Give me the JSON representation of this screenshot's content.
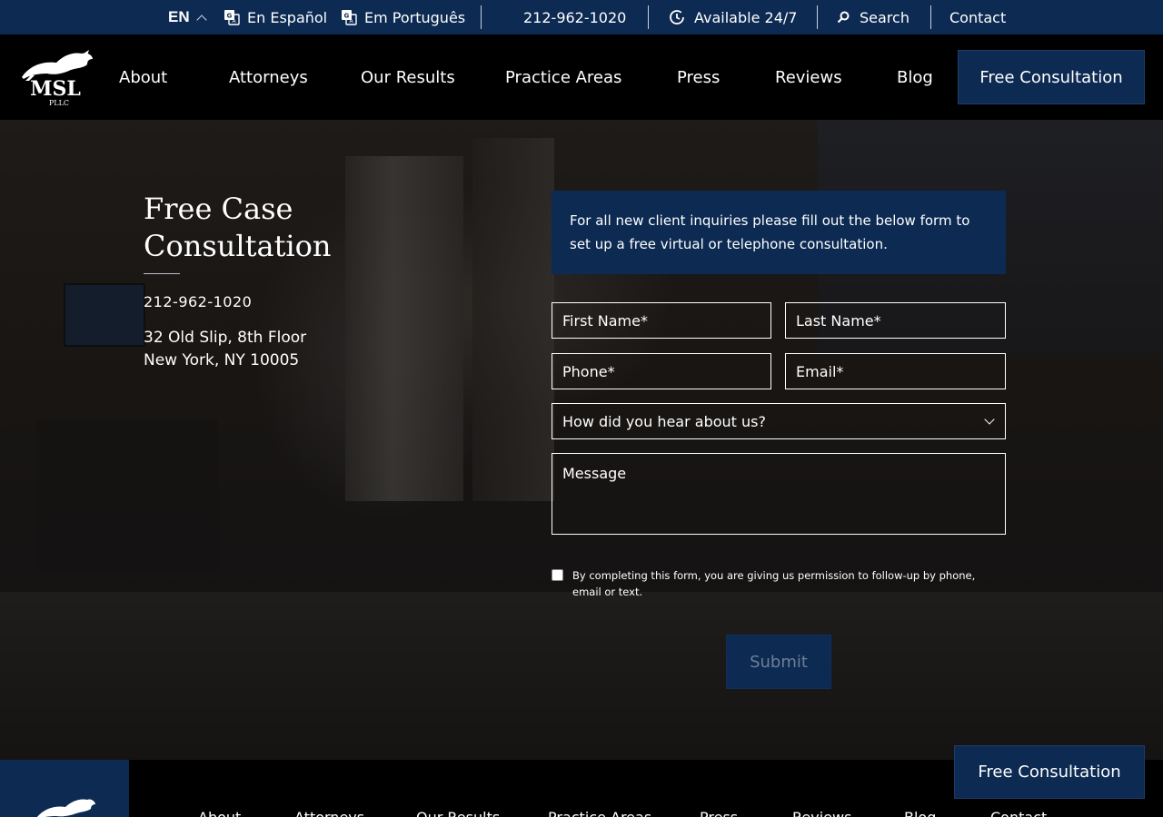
{
  "topbar": {
    "lang_current": "EN",
    "lang_es": "En Español",
    "lang_pt": "Em Português",
    "phone": "212-962-1020",
    "availability": "Available 24/7",
    "search": "Search",
    "contact": "Contact"
  },
  "logo": {
    "text": "MSL",
    "sub": "PLLC"
  },
  "nav": {
    "items": [
      "About",
      "Attorneys",
      "Our Results",
      "Practice Areas",
      "Press",
      "Reviews",
      "Blog"
    ],
    "cta": "Free Consultation"
  },
  "hero": {
    "title_line1": "Free Case",
    "title_line2": "Consultation",
    "phone": "212-962-1020",
    "address_line1": "32 Old Slip, 8th Floor",
    "address_line2": "New York, NY 10005"
  },
  "form": {
    "intro": "For all new client inquiries please fill out the below form to set up a free virtual or telephone consultation.",
    "first_name": "First Name*",
    "last_name": "Last Name*",
    "phone": "Phone*",
    "email": "Email*",
    "hear_about": "How did you hear about us?",
    "message": "Message",
    "consent": "By completing this form, you are giving us permission to follow-up by phone, email or text.",
    "consent_checked": false,
    "submit": "Submit"
  },
  "footer": {
    "nav": [
      "About",
      "Attorneys",
      "Our Results",
      "Practice Areas",
      "Press",
      "Reviews",
      "Blog",
      "Contact"
    ]
  },
  "floating_cta": "Free Consultation",
  "colors": {
    "navy": "#0c2a52",
    "black": "#000000",
    "white": "#ffffff"
  }
}
